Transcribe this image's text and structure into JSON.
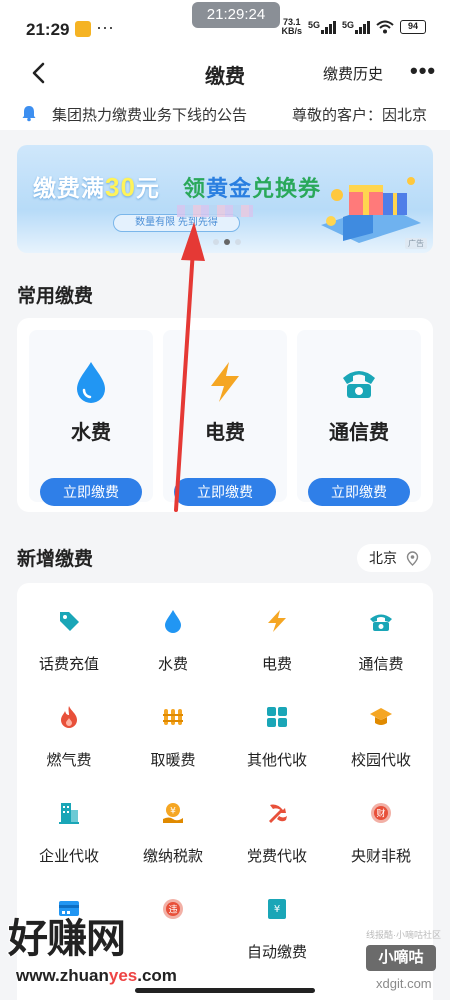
{
  "status_bar": {
    "time": "21:29",
    "center_clock": "21:29:24",
    "net_speed_value": "73.1",
    "net_speed_unit": "KB/s",
    "signal_1": "5G",
    "signal_2": "5G",
    "battery": "94"
  },
  "nav": {
    "title": "缴费",
    "history_label": "缴费历史",
    "more_label": "•••"
  },
  "notice": {
    "text_1": "集团热力缴费业务下线的公告",
    "text_2": "尊敬的客户：因北京"
  },
  "banner": {
    "headline_prefix": "缴费满",
    "headline_number": "30",
    "headline_suffix": "元",
    "headline_2_prefix": "领",
    "headline_2_highlight": "黄金",
    "headline_2_suffix": "兑换券",
    "pill": "数量有限 先到先得",
    "ad_tag": "广告",
    "active_dot": 1,
    "dot_count": 3
  },
  "common": {
    "title": "常用缴费",
    "items": [
      {
        "label": "水费",
        "button": "立即缴费",
        "icon": "water-drop-icon"
      },
      {
        "label": "电费",
        "button": "立即缴费",
        "icon": "lightning-icon"
      },
      {
        "label": "通信费",
        "button": "立即缴费",
        "icon": "telephone-icon"
      }
    ]
  },
  "new_section": {
    "title": "新增缴费",
    "city": "北京",
    "items": [
      {
        "label": "话费充值",
        "icon": "tag-icon"
      },
      {
        "label": "水费",
        "icon": "water-drop-icon"
      },
      {
        "label": "电费",
        "icon": "lightning-icon"
      },
      {
        "label": "通信费",
        "icon": "telephone-icon"
      },
      {
        "label": "燃气费",
        "icon": "flame-icon"
      },
      {
        "label": "取暖费",
        "icon": "radiator-icon"
      },
      {
        "label": "其他代收",
        "icon": "grid-apps-icon"
      },
      {
        "label": "校园代收",
        "icon": "graduation-cap-icon"
      },
      {
        "label": "企业代收",
        "icon": "building-icon"
      },
      {
        "label": "缴纳税款",
        "icon": "tax-hand-icon"
      },
      {
        "label": "党费代收",
        "icon": "party-emblem-icon"
      },
      {
        "label": "央财非税",
        "icon": "finance-seal-icon"
      },
      {
        "label": "",
        "icon": "card-icon"
      },
      {
        "label": "",
        "icon": "fine-icon"
      },
      {
        "label": "自动缴费",
        "icon": "auto-pay-icon"
      }
    ]
  },
  "watermark": {
    "logo_text": "好赚网",
    "url_prefix": "www.zhuan",
    "url_highlight": "yes",
    "url_suffix": ".com",
    "badge": "小嘀咕",
    "right_url": "xdgit.com",
    "tiny_text": "线报酷·小嘀咕社区"
  },
  "colors": {
    "primary_blue": "#2f7fe8",
    "icon_blue": "#2196f3",
    "icon_orange": "#f5a623",
    "icon_teal": "#1aa6b7",
    "icon_red": "#e8503a",
    "annotation_arrow": "#e53935"
  }
}
